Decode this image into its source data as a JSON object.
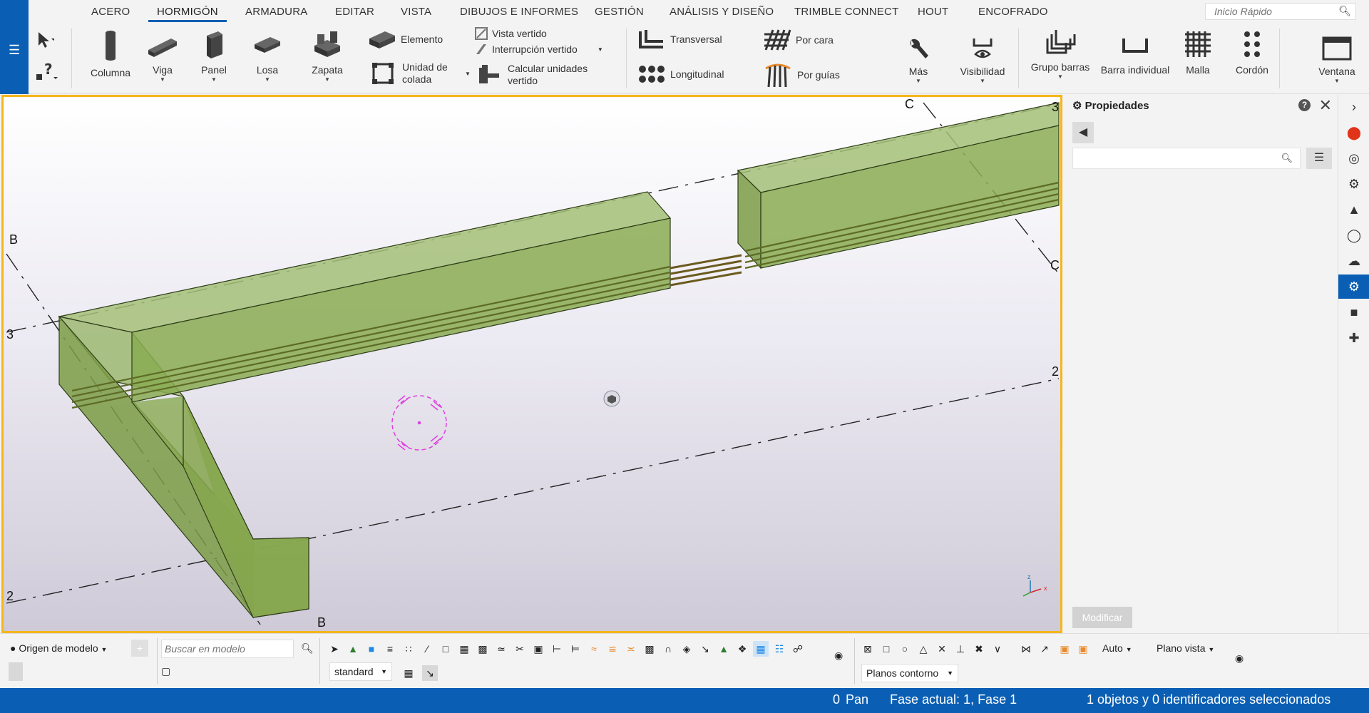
{
  "menu": {
    "tabs": [
      "ACERO",
      "HORMIGÓN",
      "ARMADURA",
      "EDITAR",
      "VISTA",
      "DIBUJOS E INFORMES",
      "GESTIÓN",
      "ANÁLISIS Y DISEÑO",
      "TRIMBLE CONNECT",
      "HOUT",
      "ENCOFRADO"
    ],
    "active_tab": "HORMIGÓN",
    "quick_placeholder": "Inicio Rápido"
  },
  "ribbon": {
    "columna": "Columna",
    "viga": "Viga",
    "panel": "Panel",
    "losa": "Losa",
    "zapata": "Zapata",
    "elemento": "Elemento",
    "unidad_colada": "Unidad de colada",
    "vista_vertido": "Vista vertido",
    "interrupcion_vertido": "Interrupción vertido",
    "calcular_unidades": "Calcular unidades vertido",
    "transversal": "Transversal",
    "longitudinal": "Longitudinal",
    "por_cara": "Por cara",
    "por_guias": "Por guías",
    "mas": "Más",
    "visibilidad": "Visibilidad",
    "grupo_barras": "Grupo barras",
    "barra_individual": "Barra individual",
    "malla": "Malla",
    "cordon": "Cordón",
    "ventana": "Ventana"
  },
  "grid_labels": {
    "b_top": "B",
    "b_bottom": "B",
    "c_top": "C",
    "c_right": "C",
    "n3_left": "3",
    "n3_right": "3",
    "n2_left": "2",
    "n2_right": "2"
  },
  "properties": {
    "title": "Propiedades",
    "help": "?",
    "search_placeholder": "",
    "modify": "Modificar"
  },
  "bottom": {
    "origin": "Origen de modelo",
    "search_placeholder": "Buscar en modelo",
    "filter": "standard",
    "auto": "Auto",
    "plane": "Plano vista",
    "contour": "Planos contorno"
  },
  "status": {
    "count": "0",
    "mode": "Pan",
    "phase": "Fase actual: 1, Fase 1",
    "selection": "1 objetos y 0 identificadores seleccionados"
  },
  "colors": {
    "accent": "#0a5fb4",
    "viewport_border": "#f5b51c",
    "concrete": "#8faf5a",
    "rebar": "#7a6a2a",
    "tool_marker": "#e040e0"
  }
}
